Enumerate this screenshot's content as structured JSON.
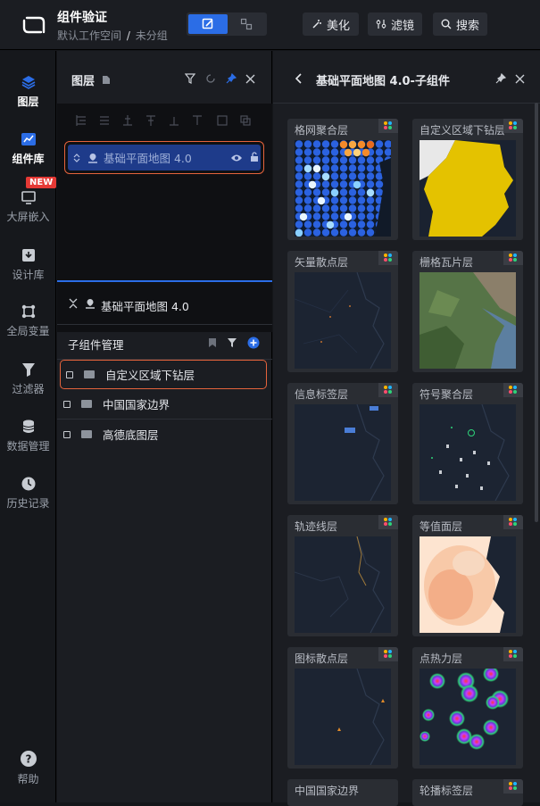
{
  "topbar": {
    "project_name": "组件验证",
    "workspace": "默认工作空间",
    "separator": "/",
    "group": "未分组",
    "beautify": "美化",
    "filter": "滤镜",
    "search": "搜索"
  },
  "nav": [
    {
      "label": "图层",
      "icon": "layers-icon"
    },
    {
      "label": "组件库",
      "icon": "chart-icon"
    },
    {
      "label": "大屏嵌入",
      "icon": "embed-icon",
      "badge": "NEW"
    },
    {
      "label": "设计库",
      "icon": "download-box-icon"
    },
    {
      "label": "全局变量",
      "icon": "variable-icon"
    },
    {
      "label": "过滤器",
      "icon": "funnel-icon"
    },
    {
      "label": "数据管理",
      "icon": "database-icon"
    },
    {
      "label": "历史记录",
      "icon": "clock-icon"
    },
    {
      "label": "帮助",
      "icon": "help-icon"
    }
  ],
  "layers": {
    "title": "图层",
    "item": "基础平面地图 4.0",
    "selected": "基础平面地图 4.0",
    "sub_title": "子组件管理",
    "children": [
      "自定义区域下钻层",
      "中国国家边界",
      "高德底图层"
    ]
  },
  "components": {
    "title": "基础平面地图 4.0-子组件",
    "items": [
      "格网聚合层",
      "自定义区域下钻层",
      "矢量散点层",
      "栅格瓦片层",
      "信息标签层",
      "符号聚合层",
      "轨迹线层",
      "等值面层",
      "图标散点层",
      "点热力层",
      "中国国家边界",
      "轮播标签层"
    ]
  },
  "colors": {
    "accent": "#2b6de6",
    "highlight": "#e5633c",
    "selected_row": "#1e3b8a"
  }
}
